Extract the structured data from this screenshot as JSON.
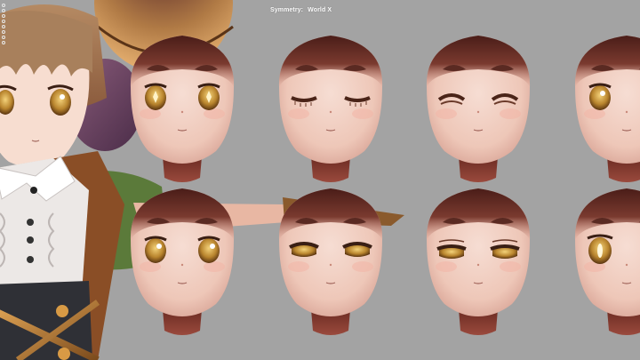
{
  "viewport": {
    "hud": {
      "symmetry_label": "Symmetry:",
      "symmetry_value": "World X"
    },
    "background_color": "#a3a3a3",
    "toolbar_icons": [
      "tool-icon",
      "tool-icon",
      "tool-icon",
      "tool-icon",
      "tool-icon",
      "tool-icon",
      "tool-icon",
      "tool-icon"
    ],
    "expressions_row1": [
      "neutral-sparkle-eyes",
      "eyes-closed",
      "eyes-squint-closed",
      "neutral"
    ],
    "expressions_row2": [
      "neutral-highlight",
      "half-lidded",
      "half-lidded-lowered",
      "wide-eyes"
    ]
  }
}
